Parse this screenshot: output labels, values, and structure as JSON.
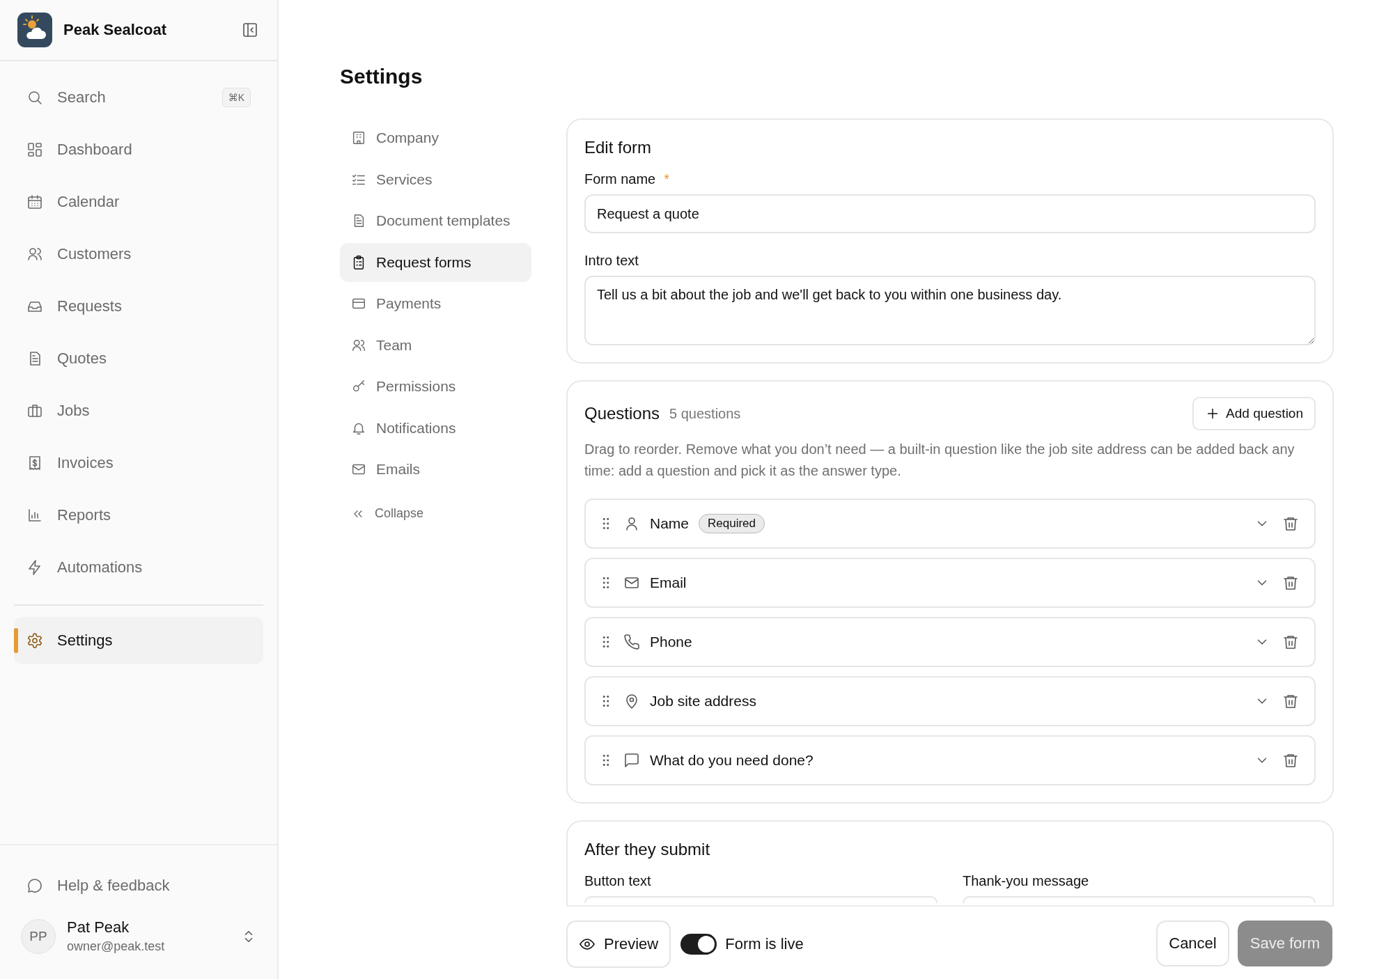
{
  "app": {
    "name": "Peak Sealcoat"
  },
  "sidebar": {
    "search": {
      "label": "Search",
      "shortcut": "⌘K"
    },
    "items": [
      {
        "label": "Dashboard",
        "selected": false
      },
      {
        "label": "Calendar",
        "selected": false
      },
      {
        "label": "Customers",
        "selected": false
      },
      {
        "label": "Requests",
        "selected": false
      },
      {
        "label": "Quotes",
        "selected": false
      },
      {
        "label": "Jobs",
        "selected": false
      },
      {
        "label": "Invoices",
        "selected": false
      },
      {
        "label": "Reports",
        "selected": false
      },
      {
        "label": "Automations",
        "selected": false
      }
    ],
    "footer_items": [
      {
        "label": "Settings",
        "selected": true
      }
    ],
    "help": "Help & feedback",
    "user": {
      "initials": "PP",
      "name": "Pat Peak",
      "email": "owner@peak.test"
    }
  },
  "page": {
    "title": "Settings"
  },
  "settings_nav": {
    "items": [
      {
        "label": "Company",
        "selected": false
      },
      {
        "label": "Services",
        "selected": false
      },
      {
        "label": "Document templates",
        "selected": false
      },
      {
        "label": "Request forms",
        "selected": true
      },
      {
        "label": "Payments",
        "selected": false
      },
      {
        "label": "Team",
        "selected": false
      },
      {
        "label": "Permissions",
        "selected": false
      },
      {
        "label": "Notifications",
        "selected": false
      },
      {
        "label": "Emails",
        "selected": false
      }
    ],
    "collapse": "Collapse"
  },
  "edit_form": {
    "title": "Edit form",
    "form_name": {
      "label": "Form name",
      "required": true,
      "required_mark": "*",
      "value": "Request a quote"
    },
    "intro_text": {
      "label": "Intro text",
      "value": "Tell us a bit about the job and we'll get back to you within one business day."
    }
  },
  "questions": {
    "title": "Questions",
    "count": "5 questions",
    "add_button": "Add question",
    "help": "Drag to reorder. Remove what you don’t need — a built-in question like the job site address can be added back any time: add a question and pick it as the answer type.",
    "items": [
      {
        "label": "Name",
        "badge": "Required"
      },
      {
        "label": "Email"
      },
      {
        "label": "Phone"
      },
      {
        "label": "Job site address"
      },
      {
        "label": "What do you need done?"
      }
    ]
  },
  "after_submit": {
    "title": "After they submit",
    "button_text": {
      "label": "Button text"
    },
    "thank_you": {
      "label": "Thank-you message"
    }
  },
  "action_bar": {
    "preview": "Preview",
    "live": {
      "label": "Form is live",
      "on": true
    },
    "cancel": "Cancel",
    "save": {
      "label": "Save form",
      "disabled": true
    }
  }
}
